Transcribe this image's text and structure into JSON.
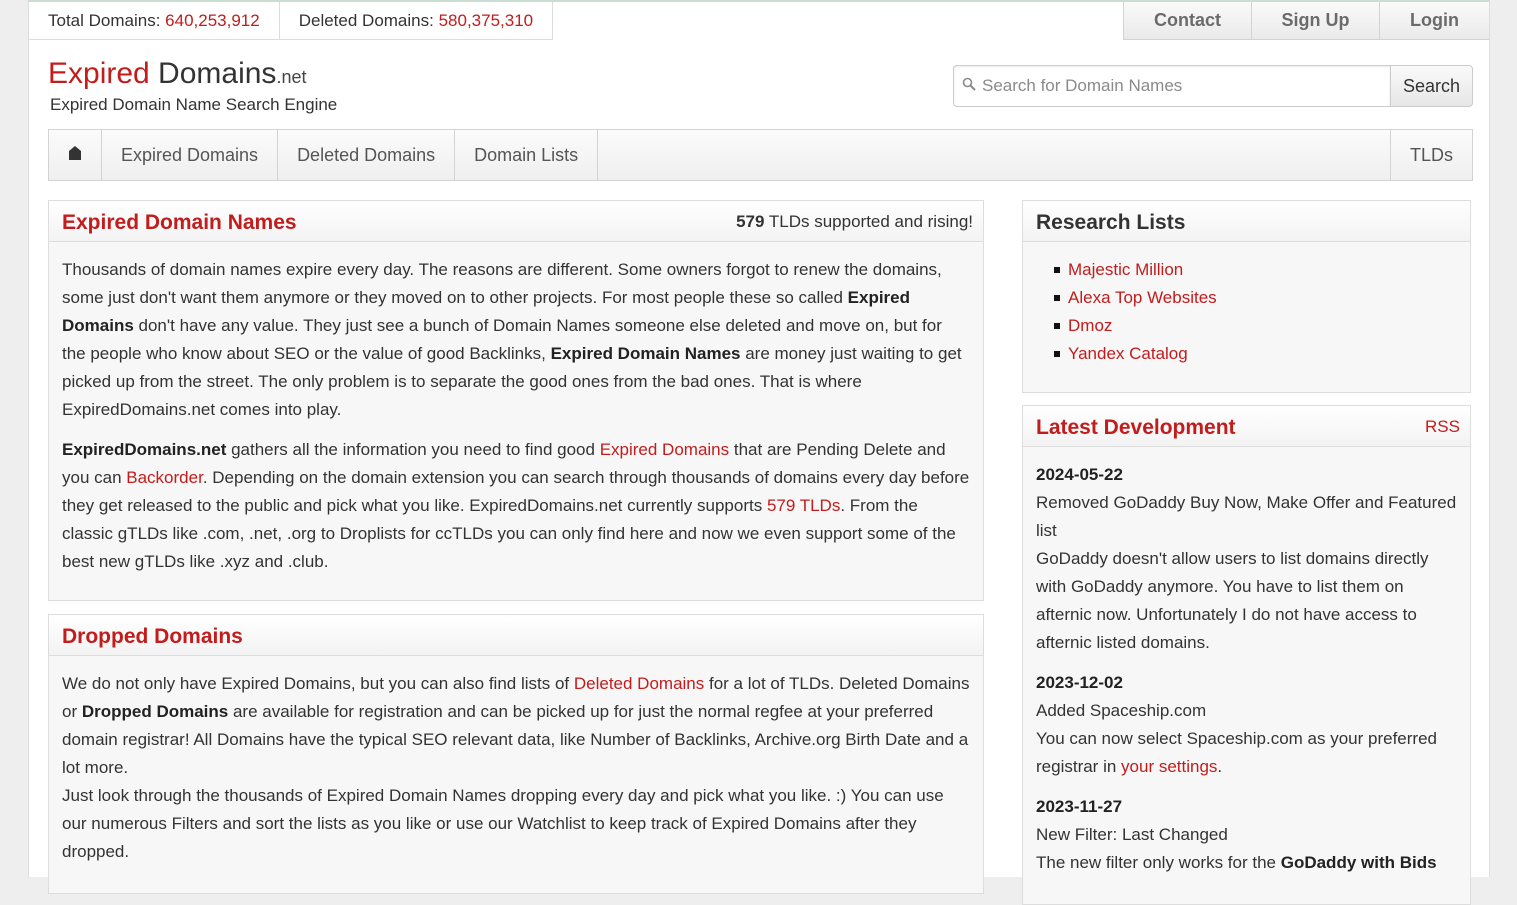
{
  "stats": {
    "total_label": "Total Domains:",
    "total_value": "640,253,912",
    "deleted_label": "Deleted Domains:",
    "deleted_value": "580,375,310"
  },
  "topnav": {
    "contact": "Contact",
    "signup": "Sign Up",
    "login": "Login"
  },
  "brand": {
    "expired": "Expired",
    "domains": " Domains",
    "tld": ".net",
    "tagline": "Expired Domain Name Search Engine"
  },
  "search": {
    "placeholder": "Search for Domain Names",
    "button": "Search"
  },
  "mainnav": {
    "home_icon": "home-icon",
    "items": [
      "Expired Domains",
      "Deleted Domains",
      "Domain Lists"
    ],
    "right": "TLDs"
  },
  "expired_panel": {
    "title": "Expired Domain Names",
    "tld_count": "579",
    "tld_text": " TLDs supported and rising!",
    "p1": {
      "a": "Thousands of domain names expire every day. The reasons are different. Some owners forgot to renew the domains, some just don't want them anymore or they moved on to other projects. For most people these so called ",
      "b1": "Expired Domains",
      "c": " don't have any value. They just see a bunch of Domain Names someone else deleted and move on, but for the people who know about SEO or the value of good Backlinks, ",
      "b2": "Expired Domain Names",
      "d": " are money just waiting to get picked up from the street. The only problem is to separate the good ones from the bad ones. That is where ExpiredDomains.net comes into play."
    },
    "p2": {
      "b1": "ExpiredDomains.net",
      "a": " gathers all the information you need to find good ",
      "link1": "Expired Domains",
      "b": " that are Pending Delete and you can ",
      "link2": "Backorder",
      "c": ". Depending on the domain extension you can search through thousands of domains every day before they get released to the public and pick what you like. ExpiredDomains.net currently supports ",
      "link3": "579 TLDs",
      "d": ". From the classic gTLDs like .com, .net, .org to Droplists for ccTLDs you can only find here and now we even support some of the best new gTLDs like .xyz and .club."
    }
  },
  "dropped_panel": {
    "title": "Dropped Domains",
    "p1": {
      "a": "We do not only have Expired Domains, but you can also find lists of ",
      "link1": "Deleted Domains",
      "b": " for a lot of TLDs. Deleted Domains or ",
      "b1": "Dropped Domains",
      "c": " are available for registration and can be picked up for just the normal regfee at your preferred domain registrar! All Domains have the typical SEO relevant data, like Number of Backlinks, Archive.org Birth Date and a lot more."
    },
    "p2": "Just look through the thousands of Expired Domain Names dropping every day and pick what you like. :) You can use our numerous Filters and sort the lists as you like or use our Watchlist to keep track of Expired Domains after they dropped."
  },
  "research_panel": {
    "title": "Research Lists",
    "items": [
      "Majestic Million",
      "Alexa Top Websites",
      "Dmoz",
      "Yandex Catalog"
    ]
  },
  "latest_panel": {
    "title": "Latest Development",
    "rss": "RSS",
    "news": [
      {
        "date": "2024-05-22",
        "headline": "Removed GoDaddy Buy Now, Make Offer and Featured list",
        "body": "GoDaddy doesn't allow users to list domains directly with GoDaddy anymore. You have to list them on afternic now. Unfortunately I do not have access to afternic listed domains."
      },
      {
        "date": "2023-12-02",
        "headline": "Added Spaceship.com",
        "body_a": "You can now select Spaceship.com as your preferred registrar in ",
        "body_link": "your settings",
        "body_b": "."
      },
      {
        "date": "2023-11-27",
        "headline": "New Filter: Last Changed",
        "body_a": "The new filter only works for the ",
        "body_bold": "GoDaddy with Bids"
      }
    ]
  }
}
